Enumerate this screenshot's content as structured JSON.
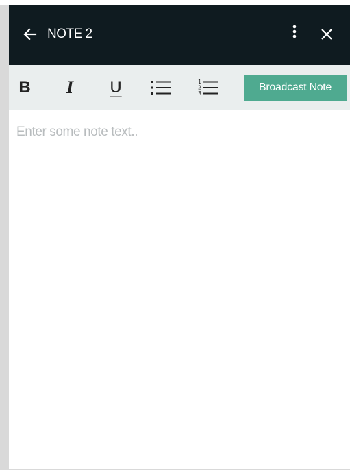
{
  "header": {
    "title": "NOTE 2",
    "back_icon": "arrow-left-icon",
    "more_icon": "more-vertical-icon",
    "close_icon": "close-icon",
    "background": "#0f1b20"
  },
  "toolbar": {
    "bold_label": "B",
    "italic_label": "I",
    "underline_label": "U",
    "bullet_list_icon": "bullet-list-icon",
    "numbered_list_icon": "numbered-list-icon",
    "broadcast_label": "Broadcast Note",
    "broadcast_color": "#4faa90",
    "background": "#eaeeee"
  },
  "editor": {
    "value": "",
    "placeholder": "Enter some note text.."
  }
}
